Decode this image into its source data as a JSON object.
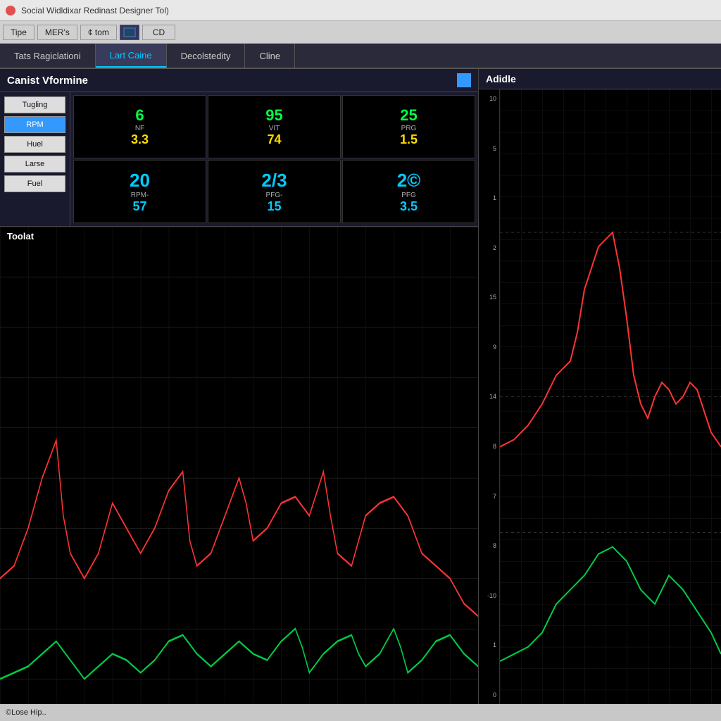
{
  "titleBar": {
    "title": "Social Widldixar Redinast Designer Tol)"
  },
  "menuBar": {
    "items": [
      "Tipe",
      "MER's",
      "¢ tom",
      "CD"
    ]
  },
  "tabs": [
    {
      "label": "Tats Ragiclationi",
      "active": false
    },
    {
      "label": "Lart Caine",
      "active": true
    },
    {
      "label": "Decolstedity",
      "active": false
    },
    {
      "label": "Cline",
      "active": false
    }
  ],
  "instrumentSection": {
    "title": "Canist Vformine",
    "controls": [
      "Tugling",
      "RPM",
      "Huel",
      "Larse",
      "Fuel"
    ],
    "activeControl": "RPM",
    "gauges": [
      {
        "topVal": "6",
        "label": "NF",
        "bottomVal": "3.3",
        "bottomColor": "yellow"
      },
      {
        "topVal": "95",
        "label": "VIT",
        "bottomVal": "74",
        "bottomColor": "yellow"
      },
      {
        "topVal": "25",
        "label": "PRG",
        "bottomVal": "1.5",
        "bottomColor": "yellow"
      },
      {
        "topVal": "20",
        "label": "RPM-",
        "bottomVal": "57",
        "bottomColor": "cyan"
      },
      {
        "topVal": "2/3",
        "label": "PFG-",
        "bottomVal": "15",
        "bottomColor": "cyan"
      },
      {
        "topVal": "2©",
        "label": "PFG",
        "bottomVal": "3.5",
        "bottomColor": "cyan"
      }
    ]
  },
  "leftChart": {
    "label": "Toolat"
  },
  "rightChart": {
    "label": "Adidle",
    "yLabels": [
      "10",
      "5",
      "1",
      "2",
      "15",
      "9",
      "14",
      "8",
      "7",
      "8",
      "-10",
      "1",
      "0"
    ]
  },
  "statusBar": {
    "text": "©Lose Hip.."
  }
}
